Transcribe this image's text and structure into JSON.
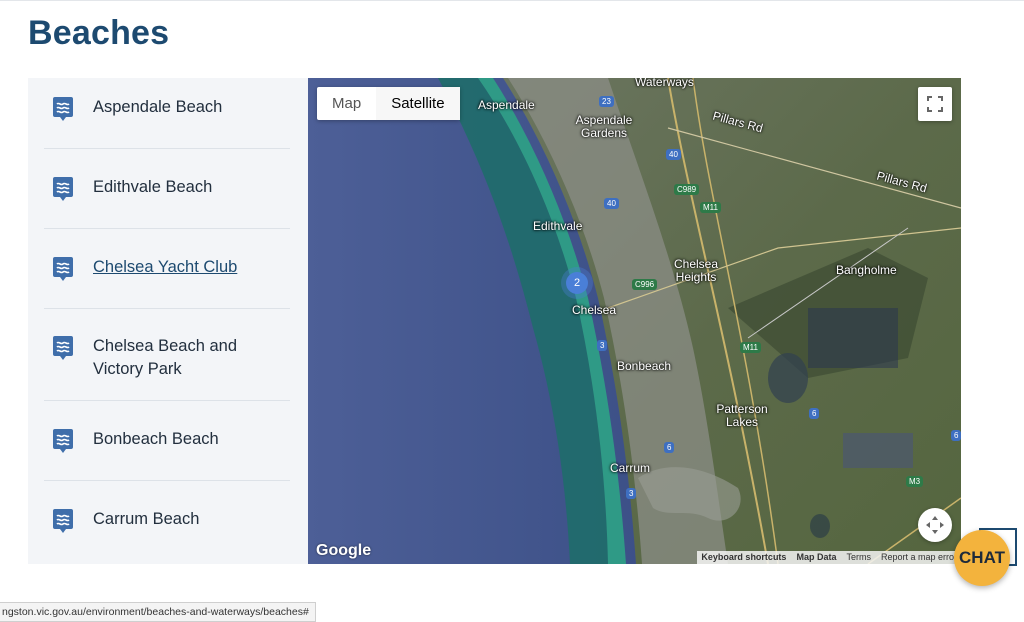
{
  "page": {
    "title": "Beaches"
  },
  "beaches": [
    {
      "label": "Aspendale Beach"
    },
    {
      "label": "Edithvale Beach"
    },
    {
      "label": "Chelsea Yacht Club"
    },
    {
      "label": "Chelsea Beach and Victory Park"
    },
    {
      "label": "Bonbeach Beach"
    },
    {
      "label": "Carrum Beach"
    }
  ],
  "map": {
    "type_buttons": {
      "map": "Map",
      "satellite": "Satellite"
    },
    "selected_type": "Satellite",
    "cluster_count": "2",
    "places": {
      "waterways": "Waterways",
      "aspendale": "Aspendale",
      "aspendale_gardens": "Aspendale Gardens",
      "pillars_rd_1": "Pillars Rd",
      "pillars_rd_2": "Pillars Rd",
      "edithvale": "Edithvale",
      "chelsea_heights": "Chelsea Heights",
      "bangholme": "Bangholme",
      "chelsea": "Chelsea",
      "bonbeach": "Bonbeach",
      "patterson_lakes": "Patterson Lakes",
      "carrum": "Carrum"
    },
    "routes": {
      "r23": "23",
      "r40a": "40",
      "r40b": "40",
      "c989": "C989",
      "m11a": "M11",
      "c996": "C996",
      "r3a": "3",
      "m11b": "M11",
      "r6a": "6",
      "r6b": "6",
      "r3b": "3",
      "m3": "M3",
      "r6c": "6"
    },
    "logo": "Google",
    "attribution": {
      "shortcuts": "Keyboard shortcuts",
      "map_data": "Map Data",
      "terms": "Terms",
      "report": "Report a map error"
    }
  },
  "chat": {
    "label": "CHAT"
  },
  "status_url": "ngston.vic.gov.au/environment/beaches-and-waterways/beaches#",
  "colors": {
    "brand": "#1d4a70",
    "chat": "#f3b33d",
    "panel": "#f3f5f8"
  }
}
